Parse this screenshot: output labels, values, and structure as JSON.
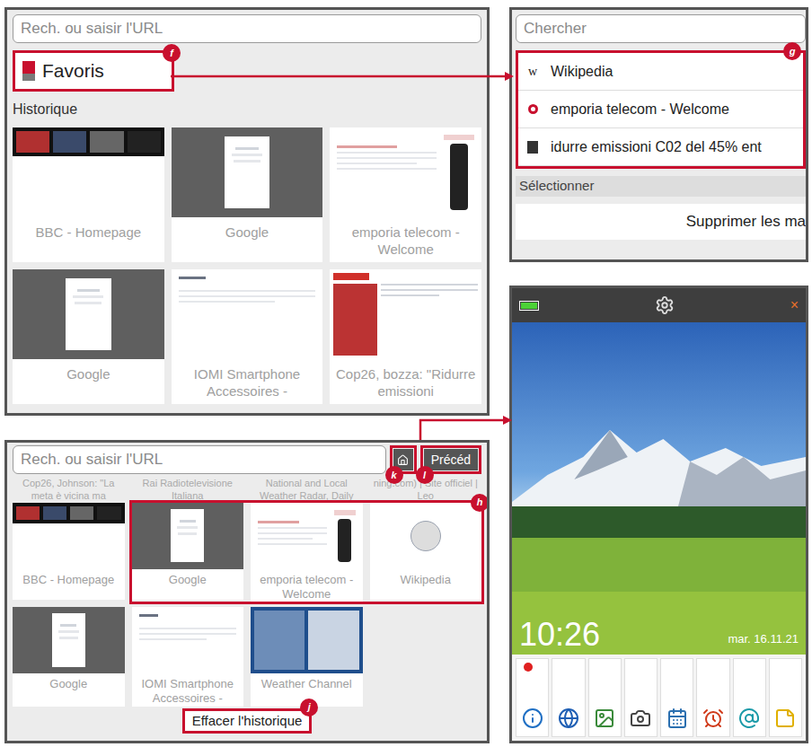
{
  "history_panel": {
    "url_placeholder": "Rech. ou saisir l'URL",
    "favorites": {
      "label": "Favoris",
      "marker": "f"
    },
    "section_title": "Historique",
    "thumbnails": [
      {
        "title": "BBC - Homepage",
        "kind": "news"
      },
      {
        "title": "Google",
        "kind": "google"
      },
      {
        "title": "emporia telecom - Welcome",
        "kind": "emporia"
      },
      {
        "title": "Google",
        "kind": "google"
      },
      {
        "title": "IOMI Smartphone Accessoires -",
        "kind": "iomi"
      },
      {
        "title": "Cop26, bozza: \"Ridurre emissioni",
        "kind": "cop26"
      }
    ]
  },
  "bookmarks_panel": {
    "search_placeholder": "Chercher",
    "marker": "g",
    "items": [
      {
        "favicon": "w",
        "label": "Wikipedia",
        "kind": "wiki"
      },
      {
        "favicon": "",
        "label": "emporia telecom - Welcome",
        "kind": "emporia"
      },
      {
        "favicon": "",
        "label": "idurre emissioni C02 del 45% ent",
        "kind": "doc"
      }
    ],
    "section_title": "Sélectionner",
    "delete_button": "Supprimer les ma"
  },
  "history_scrolled": {
    "url_placeholder": "Rech. ou saisir l'URL",
    "home_marker": "k",
    "back_button": "Précéd",
    "back_marker": "l",
    "partial_titles": [
      "Cop26, Johnson: \"La meta è vicina ma",
      "Rai Radiotelevisione Italiana",
      "National and Local Weather Radar, Daily",
      "ning.com) | Site officiel | Leo"
    ],
    "highlight_marker": "h",
    "thumbnails": [
      {
        "title": "BBC - Homepage",
        "kind": "news",
        "highlighted": false
      },
      {
        "title": "Google",
        "kind": "google",
        "highlighted": true
      },
      {
        "title": "emporia telecom - Welcome",
        "kind": "emporia",
        "highlighted": true
      },
      {
        "title": "Wikipedia",
        "kind": "wikipedia",
        "highlighted": true
      },
      {
        "title": "Google",
        "kind": "google",
        "highlighted": false
      },
      {
        "title": "IOMI Smartphone Accessoires -",
        "kind": "iomi",
        "highlighted": false
      },
      {
        "title": "Weather Channel",
        "kind": "weather",
        "highlighted": false
      }
    ],
    "clear_button": "Effacer l'historique",
    "clear_marker": "j"
  },
  "home_screen": {
    "time": "10:26",
    "date": "mar. 16.11.21",
    "close": "×",
    "dock": [
      {
        "notification": true
      },
      {
        "notification": false
      },
      {
        "notification": false
      },
      {
        "notification": false
      },
      {
        "notification": false
      },
      {
        "notification": false
      },
      {
        "notification": false
      },
      {
        "notification": false
      }
    ]
  }
}
